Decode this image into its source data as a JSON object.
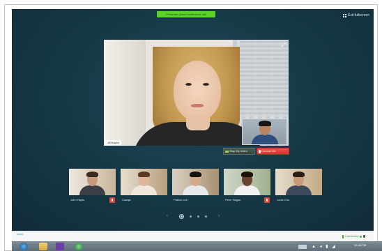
{
  "banner": {
    "text": "Presenter joined conference call"
  },
  "header": {
    "exit_label": "Exit fullscreen"
  },
  "main_video": {
    "name_label": "Jill Baylor"
  },
  "controls": {
    "stop_video_label": "Stop My Video",
    "unmute_label": "Unmute Me"
  },
  "participants": [
    {
      "name": "John Hajdu",
      "muted": true
    },
    {
      "name": "Claraje",
      "muted": false
    },
    {
      "name": "Patrick Lee",
      "muted": false
    },
    {
      "name": "Peter Hagan",
      "muted": true
    },
    {
      "name": "Louis Cho",
      "muted": false
    }
  ],
  "pager": {
    "prev": "‹",
    "next": "›",
    "pages": 4,
    "current": 1
  },
  "status": {
    "logo": "cisco",
    "connection": "Connected"
  },
  "taskbar": {
    "tray_icons": "▲ ◂ ▮ ◢",
    "clock": "12:46 PM"
  },
  "colors": {
    "stage": "#173a48",
    "banner": "#5bd22a",
    "unmute": "#d9463a"
  },
  "icons": [
    "grid-icon",
    "expand-icon",
    "camera-icon",
    "mic-off-icon",
    "mute-icon",
    "lock-icon"
  ]
}
